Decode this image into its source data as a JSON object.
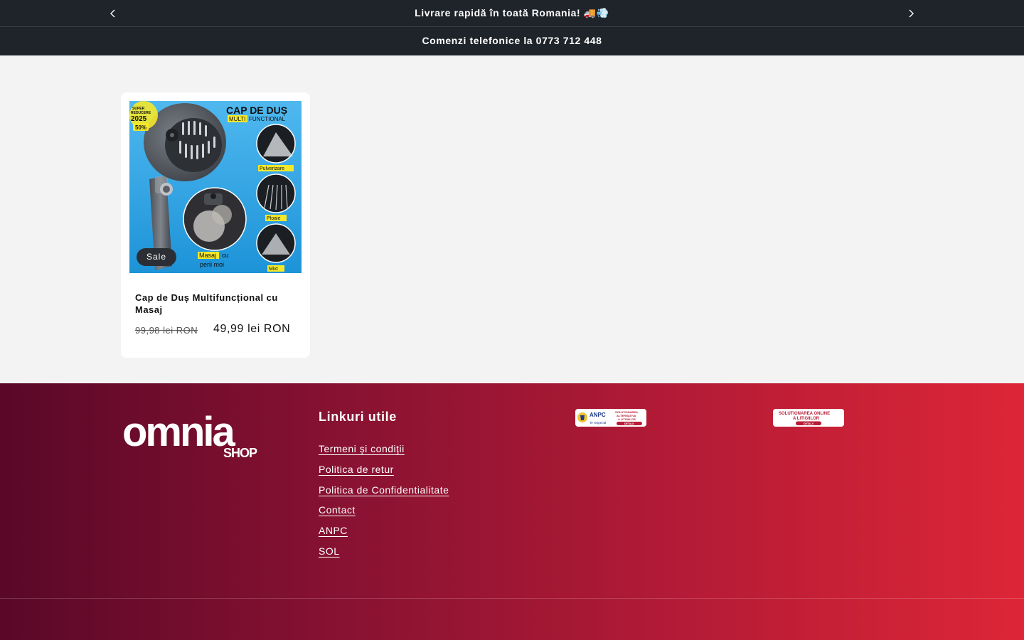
{
  "announcement": {
    "message": "Livrare rapidă în toată Romania! 🚚💨",
    "phone_message": "Comenzi telefonice la 0773 712 448",
    "prev_icon": "chevron-left-icon",
    "next_icon": "chevron-right-icon"
  },
  "product": {
    "badge": "Sale",
    "title": "Cap de Duș Multifuncțional cu Masaj",
    "price_regular": "99,98 lei RON",
    "price_sale": "49,99 lei RON",
    "image": {
      "promo_lines": [
        "SUPER",
        "REDUCERE",
        "2025",
        "50%"
      ],
      "headline": "CAP DE DUȘ",
      "headline_highlight": "MULTI",
      "headline_rest": "FUNCTIONAL",
      "modes": [
        "Pulverizare",
        "Ploaie",
        "Mixt"
      ],
      "caption_highlight": "Masaj",
      "caption_rest": "cu",
      "caption_line2": "perii moi"
    }
  },
  "footer": {
    "logo_main": "omnia",
    "logo_sub": "SHOP",
    "heading": "Linkuri utile",
    "links": [
      {
        "label": "Termeni și condiții"
      },
      {
        "label": "Politica de retur"
      },
      {
        "label": "Politica de Confidentialitate"
      },
      {
        "label": "Contact"
      },
      {
        "label": "ANPC"
      },
      {
        "label": "SOL"
      }
    ],
    "anpc_badge": {
      "title": "ANPC",
      "text1": "SOLUTIONAREA",
      "text2": "ALTERNATIVA",
      "text3": "A LITIGIILOR",
      "button": "DETALII",
      "tagline": "Te respectă"
    },
    "sol_badge": {
      "text1": "SOLUTIONAREA ONLINE",
      "text2": "A LITIGIILOR",
      "button": "DETALII"
    }
  },
  "colors": {
    "announcement_bg": "#1f242b",
    "footer_gradient_start": "#5a0828",
    "footer_gradient_end": "#dd2637",
    "image_bg": "#2aa7e6",
    "highlight_yellow": "#f5e82a"
  }
}
